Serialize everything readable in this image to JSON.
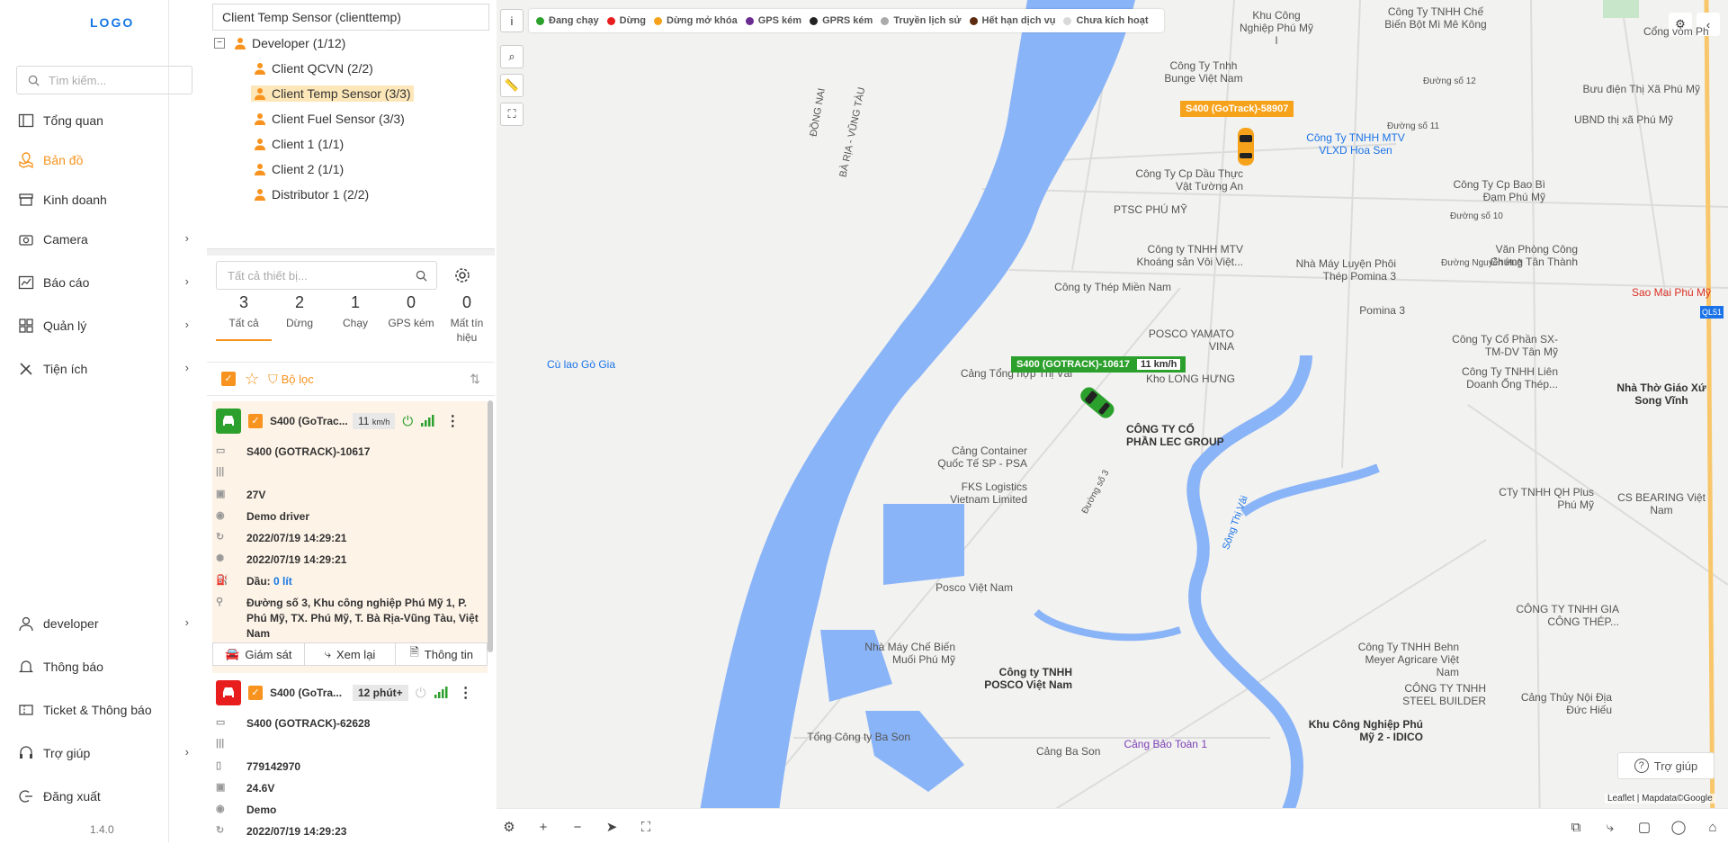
{
  "sidebar": {
    "logo_text": "LOGO",
    "search_placeholder": "Tìm kiếm...",
    "items": [
      {
        "label": "Tổng quan"
      },
      {
        "label": "Bản đồ"
      },
      {
        "label": "Kinh doanh"
      },
      {
        "label": "Camera"
      },
      {
        "label": "Báo cáo"
      },
      {
        "label": "Quản lý"
      },
      {
        "label": "Tiện ích"
      }
    ],
    "bottom_items": [
      {
        "label": "developer"
      },
      {
        "label": "Thông báo"
      },
      {
        "label": "Ticket & Thông báo"
      },
      {
        "label": "Trợ giúp"
      },
      {
        "label": "Đăng xuất"
      }
    ],
    "version": "1.4.0",
    "accent_color": "#f7931e"
  },
  "tree": {
    "selected_value": "Client Temp Sensor (clienttemp)",
    "root": "Developer (1/12)",
    "nodes": [
      "Client QCVN (2/2)",
      "Client Temp Sensor (3/3)",
      "Client Fuel Sensor (3/3)",
      "Client 1 (1/1)",
      "Client 2 (1/1)",
      "Distributor 1 (2/2)"
    ]
  },
  "devices": {
    "search_placeholder": "Tất cả thiết bị...",
    "stats": [
      {
        "count": "3",
        "label": "Tất cả"
      },
      {
        "count": "2",
        "label": "Dừng"
      },
      {
        "count": "1",
        "label": "Chạy"
      },
      {
        "count": "0",
        "label": "GPS kém"
      },
      {
        "count": "0",
        "label": "Mất tín hiệu"
      }
    ],
    "filter_label": "Bộ lọc",
    "cards": [
      {
        "name": "S400 (GoTrac...",
        "speed_value": "11",
        "speed_unit": "km/h",
        "plate": "S400 (GOTRACK)-10617",
        "voltage": "27V",
        "driver": "Demo driver",
        "time1": "2022/07/19 14:29:21",
        "time2": "2022/07/19 14:29:21",
        "fuel_label": "Dầu:",
        "fuel_value": "0 lít",
        "address": "Đường số 3, Khu công nghiệp Phú Mỹ 1, P. Phú Mỹ, TX. Phú Mỹ, T. Bà Rịa-Vũng Tàu, Việt Nam",
        "actions": [
          "Giám sát",
          "Xem lại",
          "Thông tin"
        ]
      },
      {
        "name": "S400 (GoTra...",
        "speed_value": "12 phút+",
        "plate": "S400 (GOTRACK)-62628",
        "sim": "779142970",
        "voltage": "24.6V",
        "driver": "Demo",
        "time1": "2022/07/19 14:29:23"
      }
    ]
  },
  "map": {
    "info_btn": "i",
    "legend": [
      {
        "label": "Đang chạy",
        "color": "#2ca02c"
      },
      {
        "label": "Dừng",
        "color": "#e81e1e"
      },
      {
        "label": "Dừng mở khóa",
        "color": "#f7a21b"
      },
      {
        "label": "GPS kém",
        "color": "#6a2c91"
      },
      {
        "label": "GPRS kém",
        "color": "#222222"
      },
      {
        "label": "Truyền lịch sử",
        "color": "#aaaaaa"
      },
      {
        "label": "Hết hạn dịch vụ",
        "color": "#5c2a0e"
      },
      {
        "label": "Chưa kích hoạt",
        "color": "#d9d9d9"
      }
    ],
    "vehicles": [
      {
        "label": "S400 (GoTrack)-58907",
        "color": "#f7a21b"
      },
      {
        "label": "S400 (GOTRACK)-10617",
        "speed": "11 km/h",
        "color": "#2ca02c"
      }
    ],
    "places": [
      "Khu Công Nghiệp Phú Mỹ I",
      "Công Ty TNHH Chế Biến Bột Mì Mê Kông",
      "Cổng vòm Ph",
      "Công Ty Tnhh Bunge Việt Nam",
      "Bưu điện Thị Xã Phú Mỹ",
      "UBND thị xã Phú Mỹ",
      "Công Ty TNHH MTV VLXD Hoa Sen",
      "Công Ty Cp Dầu Thực Vật Tường An",
      "Công Ty Cp Bao Bì Đạm Phú Mỹ",
      "PTSC PHÚ MỸ",
      "Công ty TNHH MTV Khoáng sản Vôi Việt...",
      "Nhà Máy Luyện Phôi Thép Pomina 3",
      "Văn Phòng Công Chứng Tân Thành",
      "Sao Mai Phú Mỹ",
      "Công ty Thép Miền Nam",
      "Pomina 3",
      "POSCO YAMATO VINA",
      "Cù lao Gò Gia",
      "Công Ty Cổ Phần SX-TM-DV Tân Mỹ",
      "Cảng Tổng hợp Thị Vải",
      "Kho LONG HƯNG",
      "Công Ty TNHH Liên Doanh Ống Thép...",
      "Nhà Thờ Giáo Xứ Song Vĩnh",
      "CÔNG TY CỔ PHẦN LEC GROUP",
      "Cảng Container Quốc Tế SP - PSA",
      "FKS Logistics Vietnam Limited",
      "CTy TNHH QH Plus Phú Mỹ",
      "CS BEARING Việt Nam",
      "Posco Việt Nam",
      "CÔNG TY TNHH GIA CÔNG THÉP...",
      "Nhà Máy Chế Biến Muối Phú Mỹ",
      "Công ty TNHH POSCO Việt Nam",
      "Công Ty TNHH Behn Meyer Agricare Việt Nam",
      "CÔNG TY TNHH STEEL BUILDER",
      "Cảng Thủy Nội Địa Đức Hiếu",
      "Tổng Công ty Ba Son",
      "Cảng Ba Son",
      "Cảng Bảo Toàn 1",
      "Khu Công Nghiệp Phú Mỹ 2 - IDICO"
    ],
    "roads": [
      "Đường số 12",
      "Đường số 11",
      "Đường số 10",
      "Đường Nguyễn Huệ",
      "Đường số 3",
      "Sông Thị Vải",
      "ĐỒNG NAI",
      "BÀ RỊA - VŨNG TÀU",
      "QL51"
    ],
    "help_label": "Trợ giúp",
    "attribution": "Leaflet | Mapdata©Google"
  }
}
